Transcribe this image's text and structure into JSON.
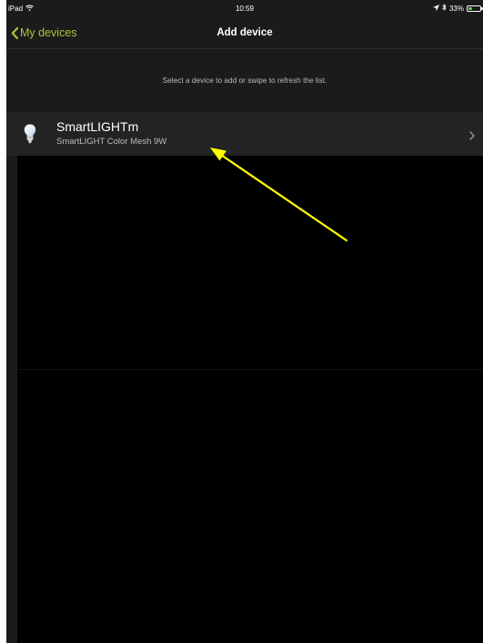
{
  "status_bar": {
    "carrier": "iPad",
    "time": "10:59",
    "battery_text": "33%",
    "battery_level": 0.33
  },
  "nav": {
    "back_label": "My devices",
    "title": "Add device"
  },
  "hint": "Select a device to add or swipe to refresh the list.",
  "devices": [
    {
      "name": "SmartLIGHTm",
      "model": "SmartLIGHT Color Mesh 9W"
    }
  ],
  "colors": {
    "accent": "#a8c83a",
    "background": "#1b1b1b",
    "row": "#232323",
    "annotation": "#ffff00"
  }
}
